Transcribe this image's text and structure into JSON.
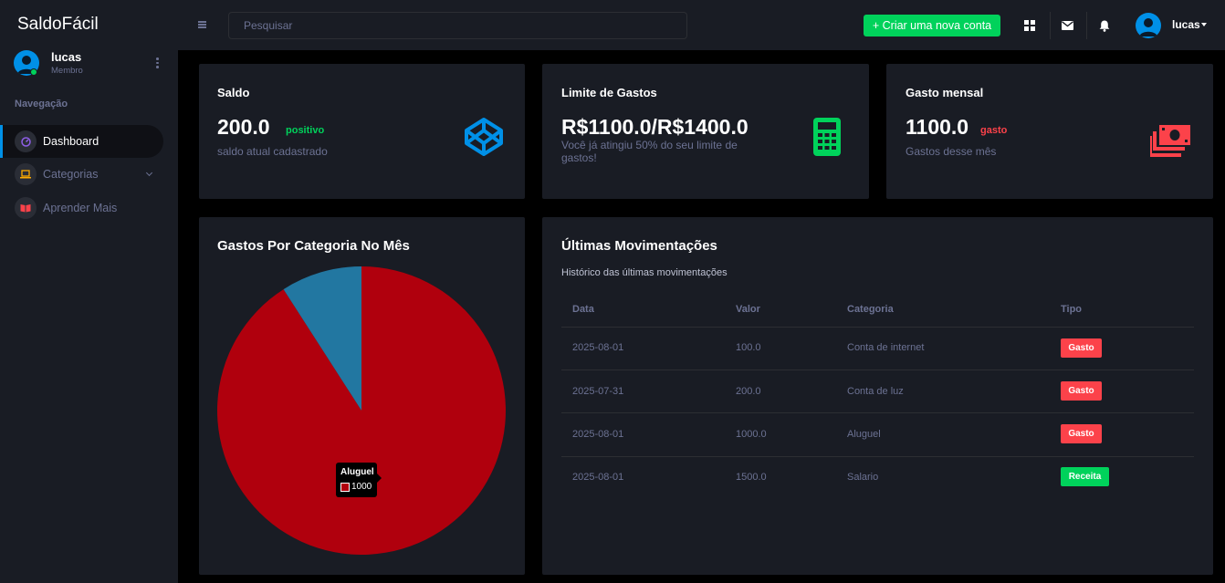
{
  "app": {
    "brand": "SaldoFácil"
  },
  "header": {
    "search_placeholder": "Pesquisar",
    "create_button": "+ Criar uma nova conta",
    "username": "lucas",
    "icons": [
      "grid-icon",
      "mail-icon",
      "bell-icon",
      "avatar"
    ]
  },
  "sidebar": {
    "user_name": "lucas",
    "user_role": "Membro",
    "nav_heading": "Navegação",
    "items": [
      {
        "label": "Dashboard",
        "icon": "speedometer-icon",
        "active": true
      },
      {
        "label": "Categorias",
        "icon": "laptop-icon",
        "active": false
      },
      {
        "label": "Aprender Mais",
        "icon": "book-icon",
        "active": false
      }
    ]
  },
  "cards": {
    "saldo": {
      "title": "Saldo",
      "value": "200.0",
      "tag": "positivo",
      "subtitle": "saldo atual cadastrado",
      "icon": "codepen-icon"
    },
    "limite": {
      "title": "Limite de Gastos",
      "value": "R$1100.0/R$1400.0",
      "subtitle": "Você já atingiu 50% do seu limite de gastos!",
      "icon": "calculator-icon"
    },
    "mensal": {
      "title": "Gasto mensal",
      "value": "1100.0",
      "tag": "gasto",
      "subtitle": "Gastos desse mês",
      "icon": "cash-icon"
    }
  },
  "colors": {
    "green": "#00d25b",
    "red": "#fc424a",
    "blue": "#0090e7",
    "pie_red": "#b0000d",
    "pie_blue": "#2277a1"
  },
  "chart_section": {
    "title": "Gastos Por Categoria No Mês"
  },
  "chart_data": {
    "type": "pie",
    "title": "Gastos Por Categoria No Mês",
    "categories": [
      "Aluguel",
      "Conta de internet"
    ],
    "values": [
      1000,
      100
    ],
    "tooltip": {
      "label": "Aluguel",
      "value": "1000"
    }
  },
  "movements": {
    "title": "Últimas Movimentações",
    "description": "Histórico das últimas movimentações",
    "columns": [
      "Data",
      "Valor",
      "Categoria",
      "Tipo"
    ],
    "rows": [
      {
        "data": "2025-08-01",
        "valor": "100.0",
        "categoria": "Conta de internet",
        "tipo": "Gasto"
      },
      {
        "data": "2025-07-31",
        "valor": "200.0",
        "categoria": "Conta de luz",
        "tipo": "Gasto"
      },
      {
        "data": "2025-08-01",
        "valor": "1000.0",
        "categoria": "Aluguel",
        "tipo": "Gasto"
      },
      {
        "data": "2025-08-01",
        "valor": "1500.0",
        "categoria": "Salario",
        "tipo": "Receita"
      }
    ]
  }
}
